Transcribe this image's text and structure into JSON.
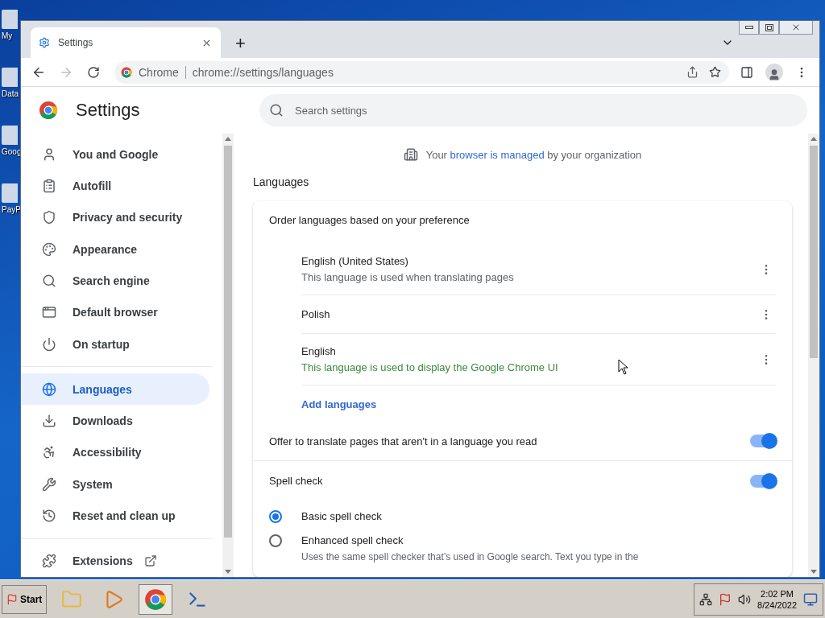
{
  "desktop_icons": [
    {
      "label": "My"
    },
    {
      "label": "Data"
    },
    {
      "label": "Goog"
    },
    {
      "label": "PayP"
    }
  ],
  "browser": {
    "tab": {
      "title": "Settings",
      "selected": true
    },
    "new_tab": "+",
    "address": {
      "origin": "Chrome",
      "url": "chrome://settings/languages"
    }
  },
  "header": {
    "title": "Settings",
    "search_placeholder": "Search settings"
  },
  "sidebar": {
    "items": [
      {
        "label": "You and Google",
        "selected": false
      },
      {
        "label": "Autofill",
        "selected": false
      },
      {
        "label": "Privacy and security",
        "selected": false
      },
      {
        "label": "Appearance",
        "selected": false
      },
      {
        "label": "Search engine",
        "selected": false
      },
      {
        "label": "Default browser",
        "selected": false
      },
      {
        "label": "On startup",
        "selected": false
      },
      {
        "label": "Languages",
        "selected": true
      },
      {
        "label": "Downloads",
        "selected": false
      },
      {
        "label": "Accessibility",
        "selected": false
      },
      {
        "label": "System",
        "selected": false
      },
      {
        "label": "Reset and clean up",
        "selected": false
      },
      {
        "label": "Extensions",
        "selected": false
      }
    ]
  },
  "notice": {
    "before": "Your ",
    "link": "browser is managed",
    "after": " by your organization"
  },
  "section_title": "Languages",
  "card": {
    "order_label": "Order languages based on your preference",
    "languages": [
      {
        "name": "English (United States)",
        "note": "This language is used when translating pages",
        "kind": "translate"
      },
      {
        "name": "Polish",
        "kind": "plain"
      },
      {
        "name": "English",
        "note": "This language is used to display the Google Chrome UI",
        "kind": "ui"
      }
    ],
    "add_link": "Add languages",
    "translate_toggle": {
      "label": "Offer to translate pages that aren't in a language you read",
      "on": true
    },
    "spell_toggle": {
      "label": "Spell check",
      "on": true
    },
    "spell_options": [
      {
        "label": "Basic spell check",
        "selected": true
      },
      {
        "label": "Enhanced spell check",
        "description": "Uses the same spell checker that’s used in Google search. Text you type in the",
        "selected": false
      }
    ]
  },
  "taskbar": {
    "start": "Start",
    "apps": [
      {
        "selected": false
      },
      {
        "selected": false
      },
      {
        "selected": true
      },
      {
        "selected": false
      }
    ],
    "time": "2:02 PM",
    "date": "8/24/2022"
  }
}
